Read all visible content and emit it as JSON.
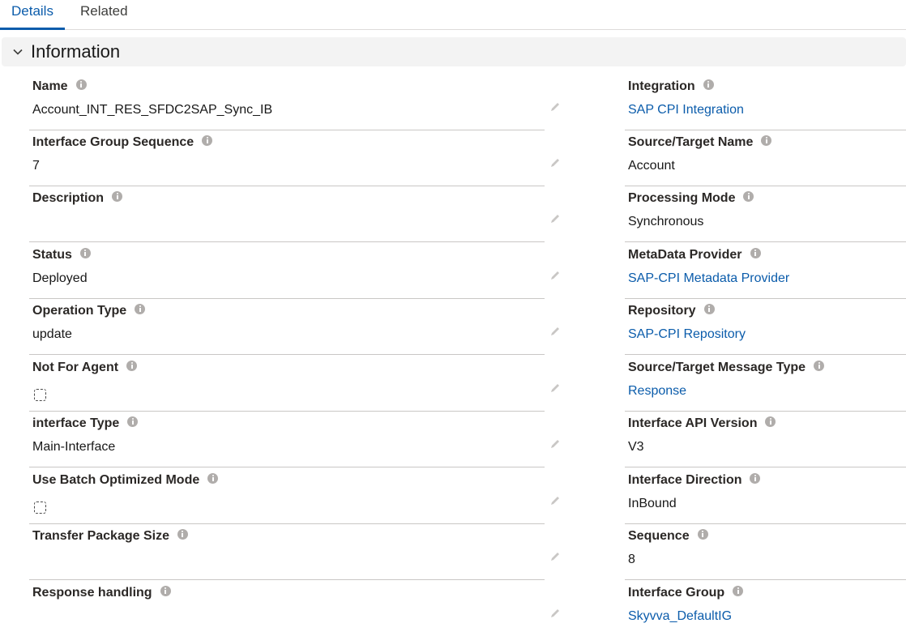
{
  "tabs": [
    {
      "label": "Details"
    },
    {
      "label": "Related"
    }
  ],
  "section": {
    "title": "Information",
    "icon": "chevron-down-icon"
  },
  "left_fields": [
    {
      "label": "Name",
      "value": "Account_INT_RES_SFDC2SAP_Sync_IB"
    },
    {
      "label": "Interface Group Sequence",
      "value": "7"
    },
    {
      "label": "Description",
      "value": ""
    },
    {
      "label": "Status",
      "value": "Deployed"
    },
    {
      "label": "Operation Type",
      "value": "update"
    },
    {
      "label": "Not For Agent",
      "value": "",
      "checked": false
    },
    {
      "label": "interface Type",
      "value": "Main-Interface"
    },
    {
      "label": "Use Batch Optimized Mode",
      "value": "",
      "checked": false
    },
    {
      "label": "Transfer Package Size",
      "value": ""
    },
    {
      "label": "Response handling",
      "value": ""
    }
  ],
  "right_fields": [
    {
      "label": "Integration",
      "value": "SAP CPI Integration"
    },
    {
      "label": "Source/Target Name",
      "value": "Account"
    },
    {
      "label": "Processing Mode",
      "value": "Synchronous"
    },
    {
      "label": "MetaData Provider",
      "value": "SAP-CPI Metadata Provider"
    },
    {
      "label": "Repository",
      "value": "SAP-CPI Repository"
    },
    {
      "label": "Source/Target Message Type",
      "value": "Response"
    },
    {
      "label": "Interface API Version",
      "value": "V3"
    },
    {
      "label": "Interface Direction",
      "value": "InBound"
    },
    {
      "label": "Sequence",
      "value": "8"
    },
    {
      "label": "Interface Group",
      "value": "Skyvva_DefaultIG"
    }
  ],
  "colors": {
    "link": "#0b5cab",
    "accent": "#0b5cab",
    "info_icon": "#b0adab"
  }
}
